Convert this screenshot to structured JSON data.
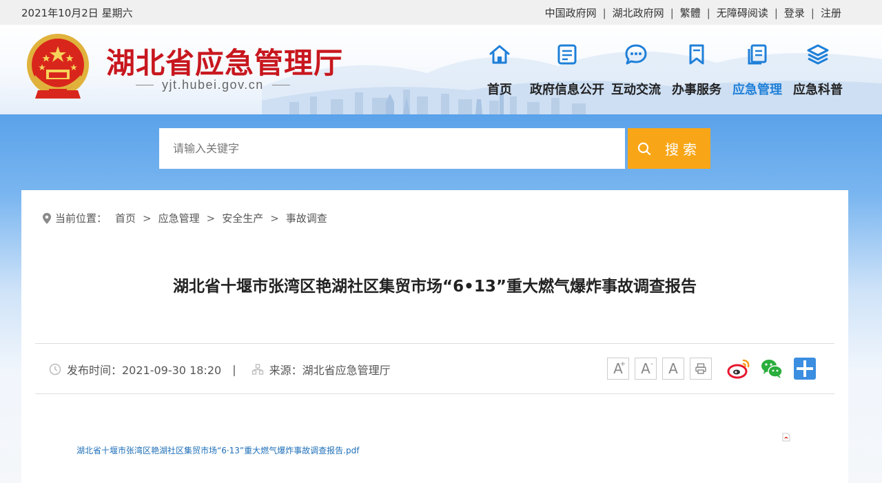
{
  "topbar": {
    "date": "2021年10月2日 星期六",
    "links": [
      "中国政府网",
      "湖北政府网",
      "繁體",
      "无障碍阅读",
      "登录",
      "注册"
    ]
  },
  "header": {
    "title": "湖北省应急管理厅",
    "url": "yjt.hubei.gov.cn"
  },
  "nav": [
    {
      "label": "首页",
      "icon": "home-icon"
    },
    {
      "label": "政府信息公开",
      "icon": "document-icon"
    },
    {
      "label": "互动交流",
      "icon": "chat-icon"
    },
    {
      "label": "办事服务",
      "icon": "bookmark-icon"
    },
    {
      "label": "应急管理",
      "icon": "pages-icon",
      "active": true
    },
    {
      "label": "应急科普",
      "icon": "layers-icon"
    }
  ],
  "search": {
    "placeholder": "请输入关键字",
    "button_label": "搜索"
  },
  "breadcrumb": {
    "lead": "当前位置：",
    "items": [
      "首页",
      "应急管理",
      "安全生产",
      "事故调查"
    ]
  },
  "article": {
    "title": "湖北省十堰市张湾区艳湖社区集贸市场“6•13”重大燃气爆炸事故调查报告",
    "publish": "发布时间：2021-09-30 18:20",
    "source": "来源：湖北省应急管理厅",
    "attachment": "湖北省十堰市张湾区艳湖社区集贸市场“6·13”重大燃气爆炸事故调查报告.pdf"
  },
  "tools": {
    "font_larger": "A",
    "font_smaller": "A",
    "font_default": "A"
  },
  "colors": {
    "brand_red": "#c8171e",
    "nav_active": "#1e7fd8",
    "search_button": "#f8a617",
    "band_blue": "#5aa2ea"
  }
}
